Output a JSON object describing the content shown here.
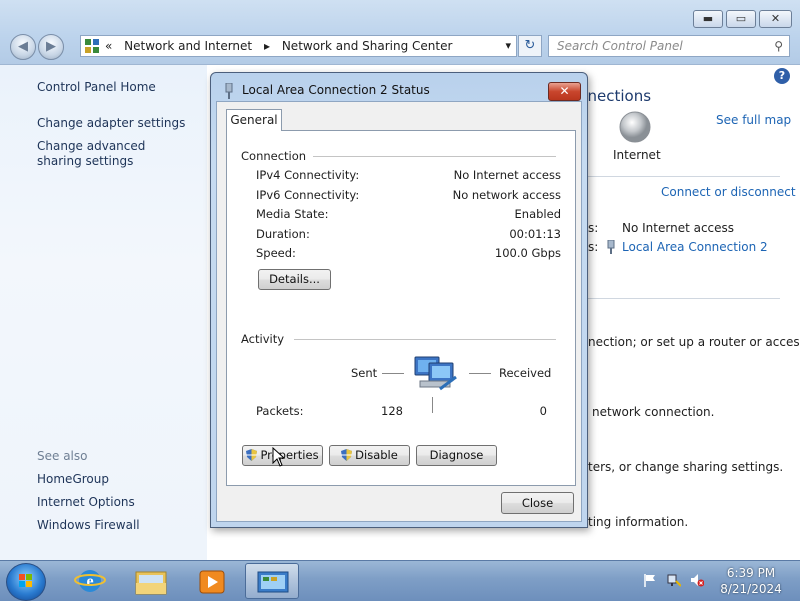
{
  "explorer": {
    "address": {
      "prefix": "«",
      "crumbs": [
        "Network and Internet",
        "▸",
        "Network and Sharing Center"
      ]
    },
    "search_placeholder": "Search Control Panel",
    "caption": {
      "min": "▬",
      "max": "▭",
      "close": "✕"
    },
    "nav": {
      "back": "◀",
      "forward": "▶",
      "refresh": "↻",
      "dropdown": "▾",
      "search_icon": "⚲",
      "help": "?"
    },
    "left_pane": {
      "home": "Control Panel Home",
      "links": [
        "Change adapter settings",
        "Change advanced sharing settings"
      ],
      "see_also_title": "See also",
      "see_also": [
        "HomeGroup",
        "Internet Options",
        "Windows Firewall"
      ]
    },
    "right_pane": {
      "heading_fragment": "nnections",
      "see_full_map": "See full map",
      "internet_label": "Internet",
      "connect_or_disconnect": "Connect or disconnect",
      "access_type_label_fragment": "s:",
      "access_type_value": "No Internet access",
      "connections_label_fragment": "s:",
      "connections_value": "Local Area Connection 2",
      "task1_fragment": "nection; or set up a router or access",
      "task2_fragment": "network connection.",
      "task3_fragment": "ters, or change sharing settings.",
      "task4_fragment": "ting information."
    }
  },
  "dialog": {
    "title": "Local Area Connection 2 Status",
    "close_glyph": "✕",
    "tab": "General",
    "connection": {
      "heading": "Connection",
      "rows": [
        {
          "label": "IPv4 Connectivity:",
          "value": "No Internet access"
        },
        {
          "label": "IPv6 Connectivity:",
          "value": "No network access"
        },
        {
          "label": "Media State:",
          "value": "Enabled"
        },
        {
          "label": "Duration:",
          "value": "00:01:13"
        },
        {
          "label": "Speed:",
          "value": "100.0 Gbps"
        }
      ],
      "details_button": "Details..."
    },
    "activity": {
      "heading": "Activity",
      "sent_label": "Sent",
      "received_label": "Received",
      "packets_label": "Packets:",
      "packets_sent": "128",
      "packets_received": "0"
    },
    "buttons": {
      "properties": "Properties",
      "disable": "Disable",
      "diagnose": "Diagnose",
      "close": "Close"
    }
  },
  "taskbar": {
    "time": "6:39 PM",
    "date": "8/21/2024"
  },
  "colors": {
    "link": "#1c64b4",
    "close_red": "#c9462d",
    "taskbar": "#7e9ec6"
  }
}
